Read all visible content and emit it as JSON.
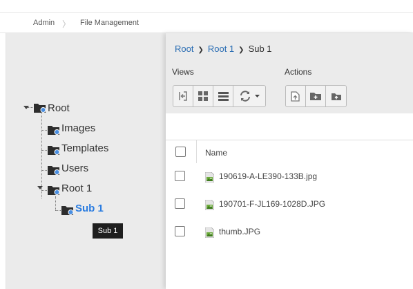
{
  "breadcrumb": {
    "items": [
      "Admin",
      "File Management"
    ],
    "separator": "〉"
  },
  "tree": {
    "nodes": [
      {
        "label": "Root",
        "expanded": true
      },
      {
        "label": "Images"
      },
      {
        "label": "Templates"
      },
      {
        "label": "Users"
      },
      {
        "label": "Root 1",
        "expanded": true
      },
      {
        "label": "Sub 1",
        "selected": true
      }
    ],
    "tooltip": "Sub 1"
  },
  "path": {
    "items": [
      "Root",
      "Root 1",
      "Sub 1"
    ],
    "arrow": "❯"
  },
  "toolbar": {
    "views_label": "Views",
    "actions_label": "Actions",
    "view_buttons": [
      "back-icon",
      "thumbnails-icon",
      "list-view-icon",
      "refresh-icon"
    ],
    "action_buttons": [
      "upload-file-icon",
      "new-folder-icon",
      "upload-folder-icon"
    ]
  },
  "grid": {
    "column_name": "Name",
    "files": [
      "190619-A-LE390-133B.jpg",
      "190701-F-JL169-1028D.JPG",
      "thumb.JPG"
    ]
  },
  "colors": {
    "link": "#2a6db3",
    "selected": "#2a7ce0",
    "panel_bg": "#ebebeb",
    "tooltip_bg": "#1e1e1e"
  }
}
